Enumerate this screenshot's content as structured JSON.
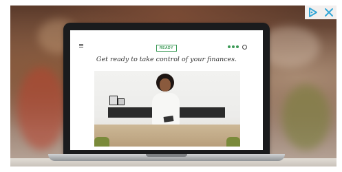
{
  "ad": {
    "brand_badge": "READY",
    "headline": "Get ready to take control of your finances.",
    "icons": {
      "menu": "hamburger-menu-icon",
      "social": [
        "social-icon-1",
        "social-icon-2",
        "social-icon-3"
      ],
      "search": "search-icon",
      "adchoices": "adchoices-icon",
      "close": "close-icon"
    },
    "colors": {
      "brand_green": "#3c9a57",
      "ad_control_blue": "#35a7d6"
    }
  }
}
